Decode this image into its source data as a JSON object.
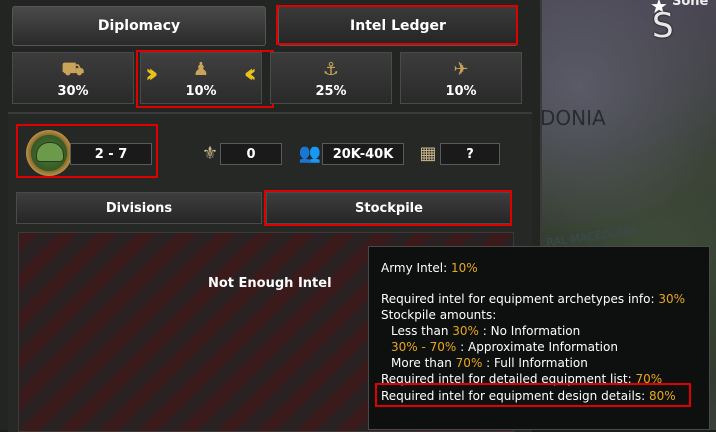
{
  "tabs": {
    "diplomacy": "Diplomacy",
    "intel": "Intel Ledger"
  },
  "categories": [
    {
      "icon": "tank-icon",
      "value": "30%"
    },
    {
      "icon": "soldier-icon",
      "value": "10%"
    },
    {
      "icon": "anchor-icon",
      "value": "25%"
    },
    {
      "icon": "plane-icon",
      "value": "10%"
    }
  ],
  "stats": {
    "army_rank": "2 - 7",
    "generals": "0",
    "manpower": "20K-40K",
    "equipment": "?"
  },
  "subtabs": {
    "divisions": "Divisions",
    "stockpile": "Stockpile"
  },
  "panel_message": "Not Enough Intel",
  "map_labels": {
    "donia": "DONIA",
    "macedonia": "RAL MACEDONIA",
    "s": "S",
    "sone": "Sone"
  },
  "tooltip": {
    "army_intel_label": "Army Intel:",
    "army_intel_value": "10%",
    "archetypes_label": "Required intel for equipment archetypes info:",
    "archetypes_value": "30%",
    "stockpile_amounts": "Stockpile amounts:",
    "less_than": "Less than",
    "less_value": "30%",
    "less_desc": ": No Information",
    "range_value": "30% - 70%",
    "range_desc": ": Approximate Information",
    "more_than": "More than",
    "more_value": "70%",
    "more_desc": ": Full Information",
    "detailed_label": "Required intel for detailed equipment list:",
    "detailed_value": "70%",
    "design_label": "Required intel for equipment design details:",
    "design_value": "80%"
  },
  "colors": {
    "highlight": "#e00000",
    "accent": "#e8a81c"
  }
}
